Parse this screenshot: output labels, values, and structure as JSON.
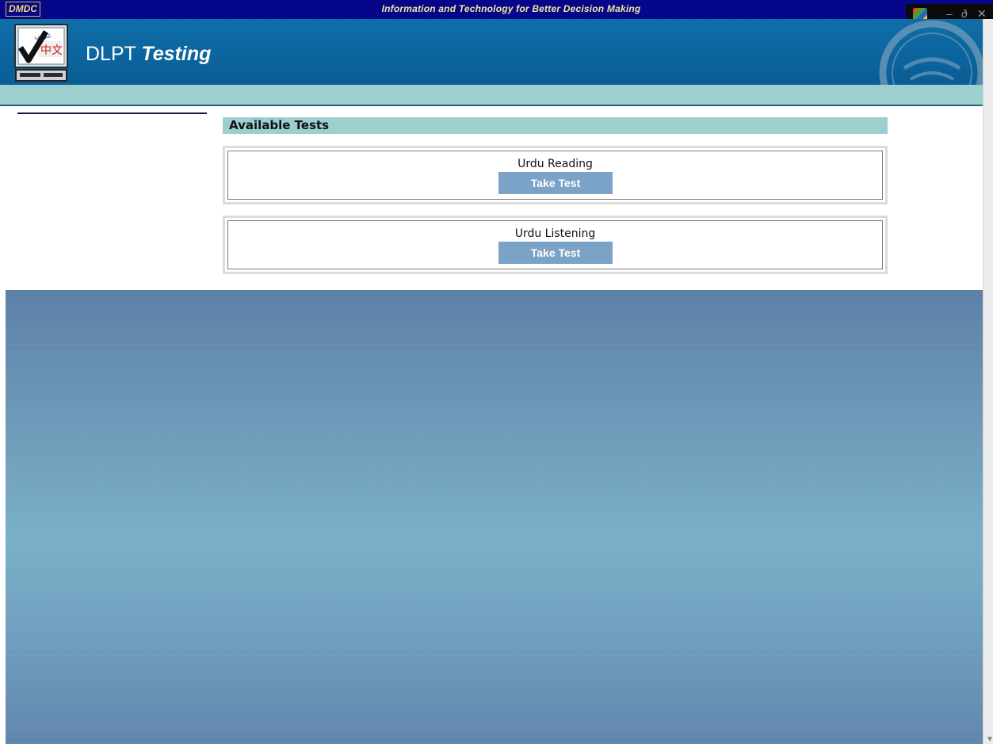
{
  "top_bar": {
    "brand": "DMDC",
    "tagline": "Information and Technology for Better Decision Making",
    "window_controls": [
      "–",
      "&#x2750;",
      "✕"
    ]
  },
  "header": {
    "title_main": "DLPT",
    "title_sub": "Testing",
    "logo_text": [
      "عربي",
      "中文"
    ]
  },
  "content": {
    "section_heading": "Available Tests",
    "tests": [
      {
        "name": "Urdu Reading",
        "button_label": "Take Test"
      },
      {
        "name": "Urdu Listening",
        "button_label": "Take Test"
      }
    ]
  },
  "colors": {
    "top_bar": "#06068a",
    "header": "#0a5d95",
    "accent_bar": "#9ccfce",
    "button": "#7ba2c7",
    "background_panel": "#6a95b5"
  },
  "icons": [
    "checkmark-computer-logo",
    "windows-flag-icon",
    "minimize-icon",
    "restore-icon",
    "close-icon",
    "dod-seal"
  ]
}
